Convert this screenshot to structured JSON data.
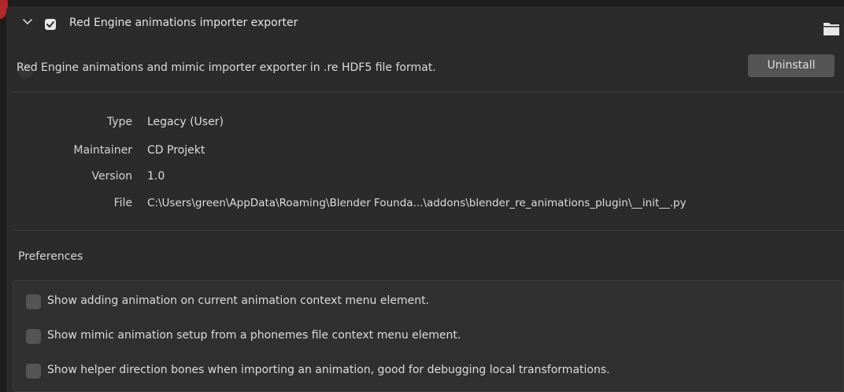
{
  "addon": {
    "title": "Red Engine animations importer exporter",
    "enabled": true,
    "description": "Red Engine animations and mimic importer exporter in .re HDF5 file format.",
    "uninstall_label": "Uninstall"
  },
  "info": {
    "type_label": "Type",
    "type_value": "Legacy (User)",
    "maintainer_label": "Maintainer",
    "maintainer_value": "CD Projekt",
    "version_label": "Version",
    "version_value": "1.0",
    "file_label": "File",
    "file_value": "C:\\Users\\green\\AppData\\Roaming\\Blender Founda...\\addons\\blender_re_animations_plugin\\__init__.py"
  },
  "preferences": {
    "label": "Preferences",
    "options": [
      {
        "label": "Show adding animation on current animation context menu element.",
        "checked": false
      },
      {
        "label": "Show mimic animation setup from a phonemes file context menu element.",
        "checked": false
      },
      {
        "label": "Show helper direction bones when importing an animation, good for debugging local transformations.",
        "checked": false
      }
    ]
  },
  "colors": {
    "background": "#1d1d1d",
    "panel": "#2b2b2b",
    "button": "#555555",
    "checkbox_unchecked": "#545454",
    "checkbox_checked": "#e9e9e9",
    "accent_red": "#b12a2a"
  },
  "icons": {
    "expand": "chevron-down-icon",
    "enabled": "checkmark-icon",
    "folder": "folder-icon"
  }
}
